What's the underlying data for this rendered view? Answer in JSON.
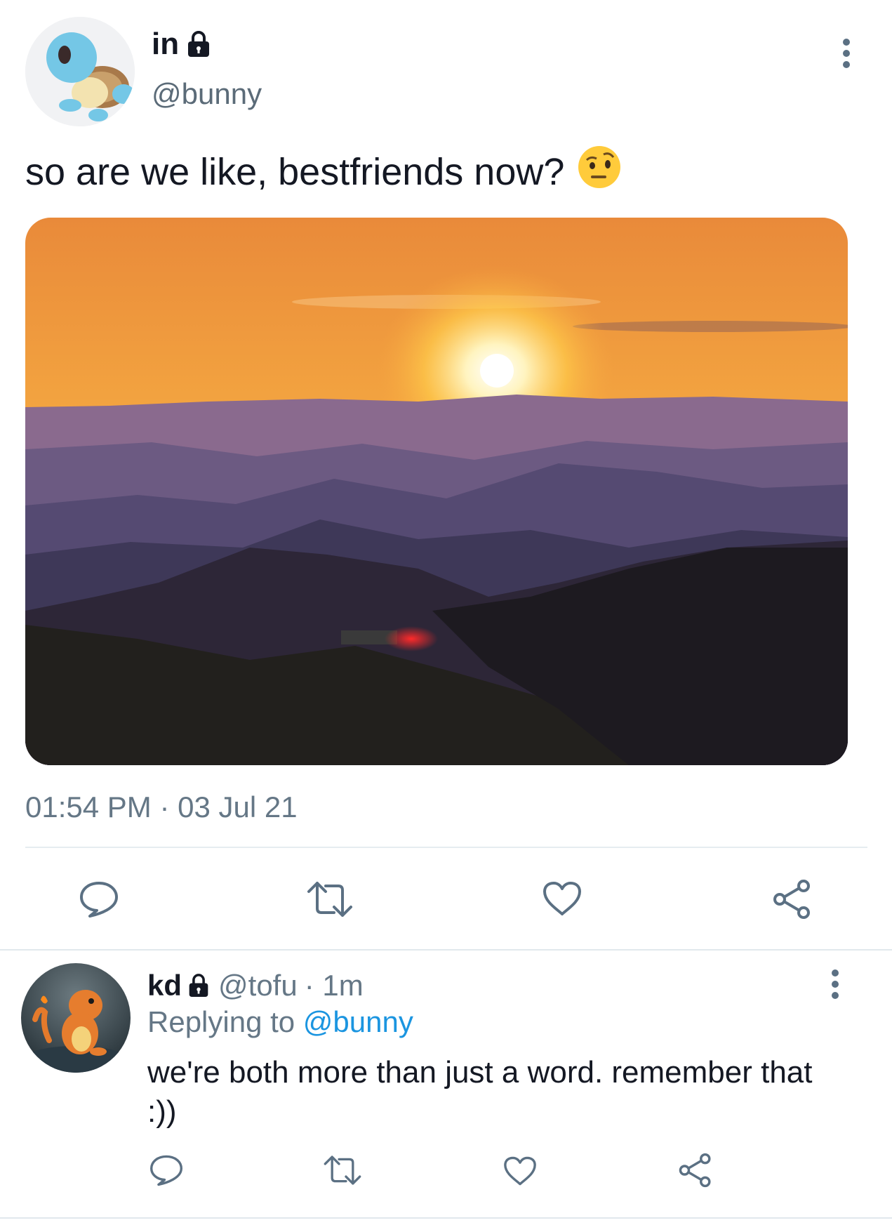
{
  "main_tweet": {
    "display_name": "in",
    "handle": "@bunny",
    "text": "so are we like, bestfriends now?",
    "emoji_name": "raised-eyebrow-emoji",
    "timestamp": "01:54 PM · 03 Jul 21"
  },
  "reply": {
    "display_name": "kd",
    "handle": "@tofu",
    "time": "· 1m",
    "replying_label": "Replying to",
    "replying_handle": "@bunny",
    "text": "we're both more than just a word. remember that :))"
  },
  "icons": [
    "lock-icon",
    "more-options-icon",
    "reply-icon",
    "retweet-icon",
    "like-icon",
    "share-icon"
  ],
  "colors": {
    "link": "#1b95e0",
    "muted": "#657786",
    "icon": "#5b7083",
    "divider": "#e6ecf0"
  }
}
